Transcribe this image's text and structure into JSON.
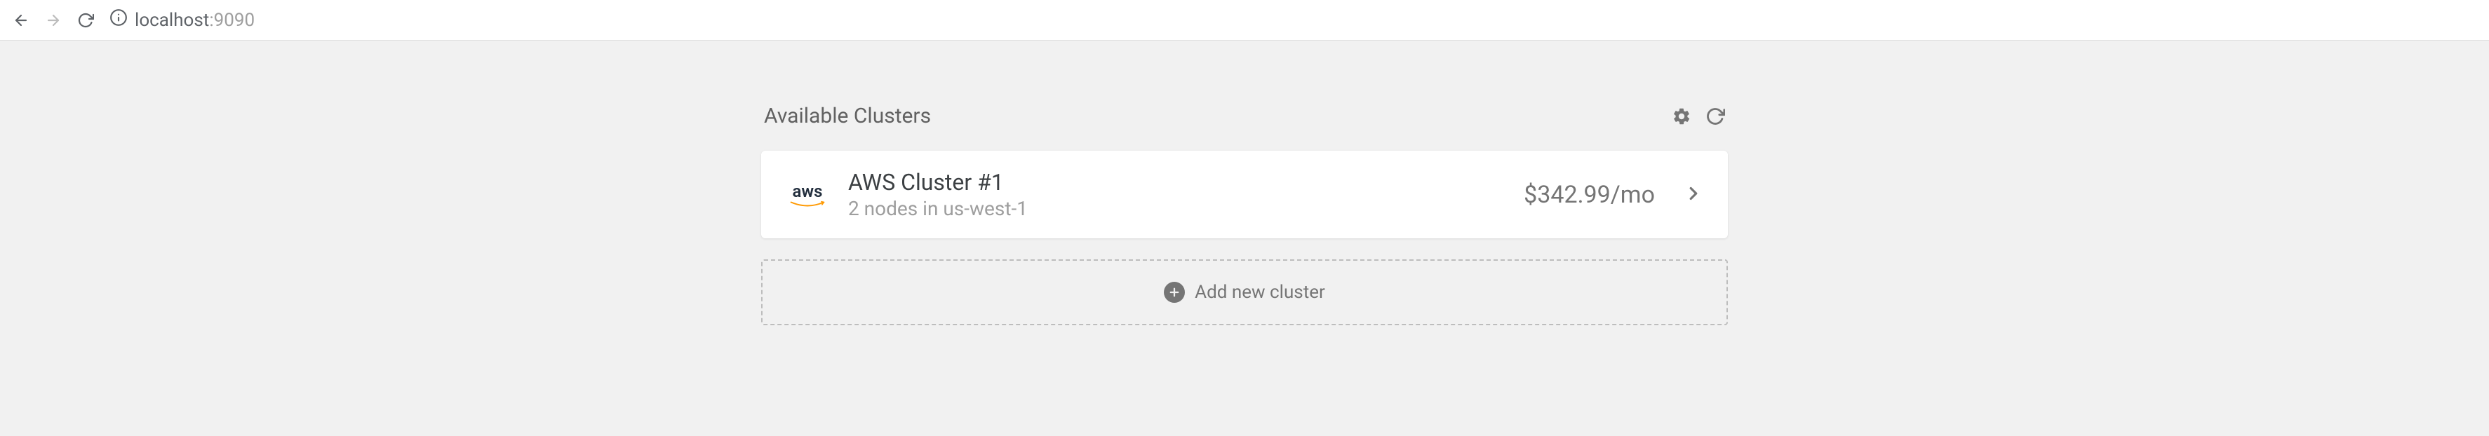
{
  "browser": {
    "url_host": "localhost",
    "url_port": ":9090"
  },
  "page": {
    "title": "Available Clusters",
    "clusters": [
      {
        "provider_label": "aws",
        "name": "AWS Cluster #1",
        "subtitle": "2 nodes in us-west-1",
        "price": "$342.99/mo"
      }
    ],
    "add_label": "Add new cluster"
  }
}
